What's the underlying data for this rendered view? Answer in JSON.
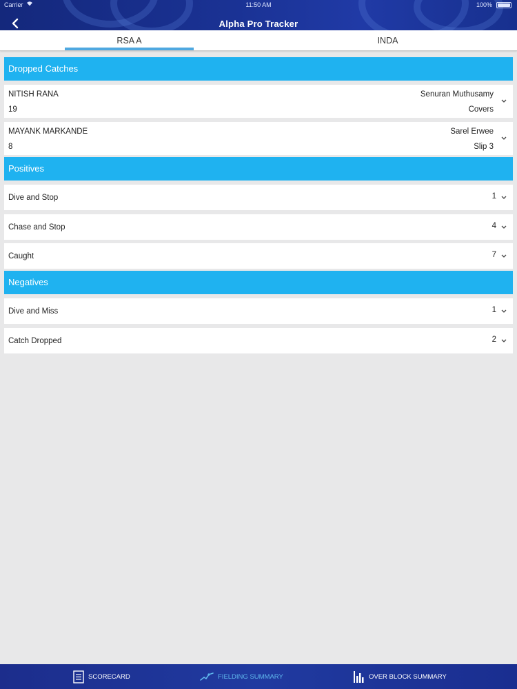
{
  "status_bar": {
    "carrier": "Carrier",
    "time": "11:50 AM",
    "battery": "100%"
  },
  "header": {
    "title": "Alpha Pro Tracker"
  },
  "tabs": [
    {
      "label": "RSA A",
      "active": true
    },
    {
      "label": "INDA",
      "active": false
    }
  ],
  "colors": {
    "section": "#1fb2f0",
    "header": "#1a3294",
    "tab_indicator": "#4fa8e0",
    "nav_active": "#5fb6ec"
  },
  "sections": {
    "dropped_catches": {
      "title": "Dropped Catches",
      "items": [
        {
          "batter": "NITISH RANA",
          "runs": "19",
          "fielder": "Senuran Muthusamy",
          "position": "Covers"
        },
        {
          "batter": "MAYANK MARKANDE",
          "runs": "8",
          "fielder": "Sarel Erwee",
          "position": "Slip 3"
        }
      ]
    },
    "positives": {
      "title": "Positives",
      "items": [
        {
          "label": "Dive and Stop",
          "count": "1"
        },
        {
          "label": "Chase and Stop",
          "count": "4"
        },
        {
          "label": "Caught",
          "count": "7"
        }
      ]
    },
    "negatives": {
      "title": "Negatives",
      "items": [
        {
          "label": "Dive and Miss",
          "count": "1"
        },
        {
          "label": "Catch Dropped",
          "count": "2"
        }
      ]
    }
  },
  "bottom_nav": [
    {
      "label": "SCORECARD",
      "icon": "scorecard-icon",
      "active": false
    },
    {
      "label": "FIELDING SUMMARY",
      "icon": "fielding-icon",
      "active": true
    },
    {
      "label": "OVER BLOCK SUMMARY",
      "icon": "bar-chart-icon",
      "active": false
    }
  ]
}
